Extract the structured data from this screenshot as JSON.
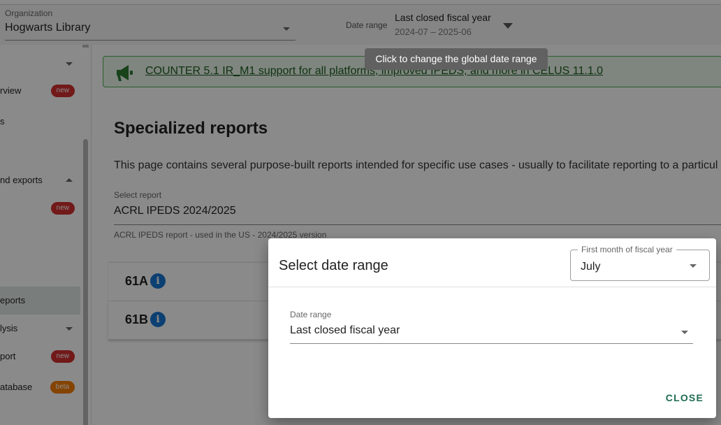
{
  "topbar": {
    "org_label": "Organization",
    "org_value": "Hogwarts Library",
    "date_range_label": "Date range",
    "date_range_title": "Last closed fiscal year",
    "date_range_value": "2024-07 – 2025-06"
  },
  "sidebar": {
    "items": [
      {
        "label": "",
        "kind": "expand-down"
      },
      {
        "label": "rview",
        "badge": "new"
      },
      {
        "label": "s"
      },
      {
        "label": "nd exports",
        "kind": "expand-up"
      },
      {
        "label": "",
        "badge": "new"
      },
      {
        "label": "eports",
        "active": true
      },
      {
        "label": "lysis",
        "kind": "expand-down"
      },
      {
        "label": "port",
        "badge": "new"
      },
      {
        "label": "atabase",
        "badge": "beta"
      }
    ]
  },
  "announcement": {
    "icon": "megaphone-icon",
    "text": "COUNTER 5.1 IR_M1 support for all platforms, improved IPEDS, and more in CELUS 11.1.0"
  },
  "page": {
    "title": "Specialized reports",
    "description": "This page contains several purpose-built reports intended for specific use cases - usually to facilitate reporting to a particul",
    "select_label": "Select report",
    "select_value": "ACRL IPEDS 2024/2025",
    "select_hint": "ACRL IPEDS report - used in the US - 2024/2025 version",
    "panels": [
      {
        "title": "61A"
      },
      {
        "title": "61B"
      }
    ]
  },
  "tooltip": {
    "text": "Click to change the global date range"
  },
  "dialog": {
    "title": "Select date range",
    "fiscal_label": "First month of fiscal year",
    "fiscal_value": "July",
    "date_range_label": "Date range",
    "date_range_value": "Last closed fiscal year",
    "close_label": "CLOSE"
  },
  "colors": {
    "accent": "#1e6b52",
    "badge_new": "#d32f2f",
    "badge_beta": "#f57c00",
    "announcement_border": "#4caf50",
    "info_icon": "#1976d2"
  }
}
